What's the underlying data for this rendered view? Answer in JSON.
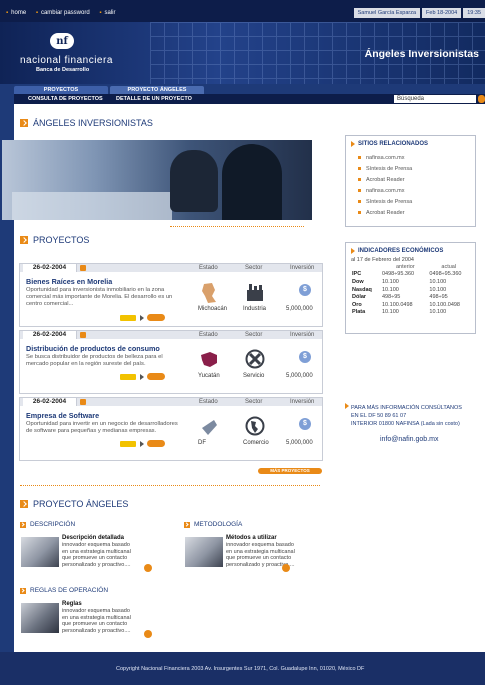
{
  "topbar": {
    "links": [
      "home",
      "cambiar password",
      "salir"
    ],
    "user": "Samuel García Esparza",
    "date": "Feb 18-2004",
    "time": "19:35"
  },
  "header": {
    "logo_mark": "nf",
    "brand": "nacional financiera",
    "brand_sub": "Banca de Desarrollo",
    "title": "Ángeles Inversionistas"
  },
  "tabs": [
    "PROYECTOS",
    "PROYECTO ÁNGELES"
  ],
  "subnav": [
    "CONSULTA DE PROYECTOS",
    "DETALLE DE UN PROYECTO"
  ],
  "search": {
    "value": "Búsqueda"
  },
  "main": {
    "title": "ÁNGELES INVERSIONISTAS",
    "projects_title": "PROYECTOS",
    "col_headers": [
      "Estado",
      "Sector",
      "Inversión"
    ],
    "projects": [
      {
        "date": "26-02-2004",
        "title": "Bienes Raíces en Morelia",
        "desc": "Oportunidad para inversionista inmobiliario en la zona comercial más importante de Morelia. El desarrollo es un centro comercial...",
        "state": "Michoacán",
        "sector": "Industria",
        "investment": "5,000,000"
      },
      {
        "date": "26-02-2004",
        "title": "Distribución de productos de consumo",
        "desc": "Se busca distribuidor de productos de belleza para el mercado popular en la región sureste del país.",
        "state": "Yucatán",
        "sector": "Servicio",
        "investment": "5,000,000"
      },
      {
        "date": "26-02-2004",
        "title": "Empresa de Software",
        "desc": "Oportunidad para invertir en un negocio de desarrolladores de software para pequeñas y medianas empresas.",
        "state": "DF",
        "sector": "Comercio",
        "investment": "5,000,000"
      }
    ],
    "more_projects": "MÁS PROYECTOS",
    "angeles_title": "PROYECTO ÁNGELES",
    "cards": [
      {
        "section": "DESCRIPCIÓN",
        "title": "Descripción detallada",
        "desc": "innovador esquema basado en una estrategia multicanal que promueve un contacto personalizado y proactivo...."
      },
      {
        "section": "METODOLOGÍA",
        "title": "Métodos a utilizar",
        "desc": "innovador esquema basado en una estrategia multicanal que promueve un contacto personalizado y proactivo...."
      },
      {
        "section": "REGLAS DE OPERACIÓN",
        "title": "Reglas",
        "desc": "innovador esquema basado en una estrategia multicanal que promueve un contacto personalizado y proactivo...."
      }
    ]
  },
  "sidebar": {
    "related_title": "SITIOS RELACIONADOS",
    "related": [
      "nafinsa.com.mx",
      "Síntesis de Prensa",
      "Acrobat Reader",
      "nafinsa.com.mx",
      "Síntesis de Prensa",
      "Acrobat Reader"
    ],
    "indicators_title": "INDICADORES ECONÓMICOS",
    "indicators_date": "al 17 de Febrero del 2004",
    "indicators_cols": [
      "anterior",
      "actual"
    ],
    "indicators": [
      {
        "label": "IPC",
        "prev": "0498÷95.360",
        "cur": "0498÷95.360"
      },
      {
        "label": "Dow",
        "prev": "10.100",
        "cur": "10.100"
      },
      {
        "label": "Nasdaq",
        "prev": "10.100",
        "cur": "10.100"
      },
      {
        "label": "Dólar",
        "prev": "498÷95",
        "cur": "498÷95"
      },
      {
        "label": "Oro",
        "prev": "10.100.0498",
        "cur": "10.100.0498"
      },
      {
        "label": "Plata",
        "prev": "10.100",
        "cur": "10.100"
      }
    ],
    "contact_title": "PARA MÁS INFORMACIÓN CONSÚLTANOS",
    "contact_line1": "EN EL DF 50 89 61 07",
    "contact_line2": "INTERIOR 01800 NAFINSA (Lada sin costo)",
    "email": "info@nafin.gob.mx"
  },
  "footer": {
    "text": "Copyright Nacional Financiera 2003 Av. Insurgentes Sur 1971, Col. Guadalupe Inn, 01020, México DF"
  }
}
